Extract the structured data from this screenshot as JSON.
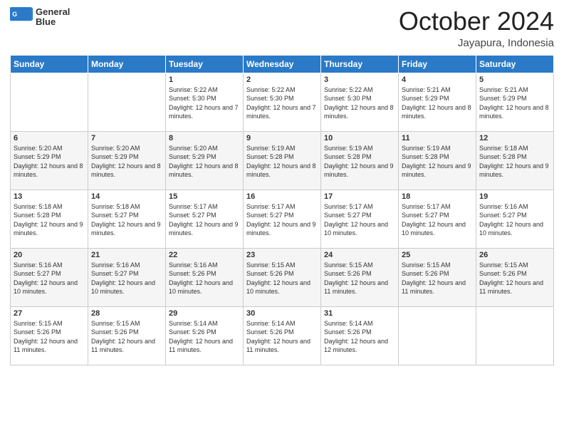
{
  "header": {
    "logo_line1": "General",
    "logo_line2": "Blue",
    "month": "October 2024",
    "location": "Jayapura, Indonesia"
  },
  "weekdays": [
    "Sunday",
    "Monday",
    "Tuesday",
    "Wednesday",
    "Thursday",
    "Friday",
    "Saturday"
  ],
  "weeks": [
    [
      {
        "day": "",
        "sunrise": "",
        "sunset": "",
        "daylight": ""
      },
      {
        "day": "",
        "sunrise": "",
        "sunset": "",
        "daylight": ""
      },
      {
        "day": "1",
        "sunrise": "Sunrise: 5:22 AM",
        "sunset": "Sunset: 5:30 PM",
        "daylight": "Daylight: 12 hours and 7 minutes."
      },
      {
        "day": "2",
        "sunrise": "Sunrise: 5:22 AM",
        "sunset": "Sunset: 5:30 PM",
        "daylight": "Daylight: 12 hours and 7 minutes."
      },
      {
        "day": "3",
        "sunrise": "Sunrise: 5:22 AM",
        "sunset": "Sunset: 5:30 PM",
        "daylight": "Daylight: 12 hours and 8 minutes."
      },
      {
        "day": "4",
        "sunrise": "Sunrise: 5:21 AM",
        "sunset": "Sunset: 5:29 PM",
        "daylight": "Daylight: 12 hours and 8 minutes."
      },
      {
        "day": "5",
        "sunrise": "Sunrise: 5:21 AM",
        "sunset": "Sunset: 5:29 PM",
        "daylight": "Daylight: 12 hours and 8 minutes."
      }
    ],
    [
      {
        "day": "6",
        "sunrise": "Sunrise: 5:20 AM",
        "sunset": "Sunset: 5:29 PM",
        "daylight": "Daylight: 12 hours and 8 minutes."
      },
      {
        "day": "7",
        "sunrise": "Sunrise: 5:20 AM",
        "sunset": "Sunset: 5:29 PM",
        "daylight": "Daylight: 12 hours and 8 minutes."
      },
      {
        "day": "8",
        "sunrise": "Sunrise: 5:20 AM",
        "sunset": "Sunset: 5:29 PM",
        "daylight": "Daylight: 12 hours and 8 minutes."
      },
      {
        "day": "9",
        "sunrise": "Sunrise: 5:19 AM",
        "sunset": "Sunset: 5:28 PM",
        "daylight": "Daylight: 12 hours and 8 minutes."
      },
      {
        "day": "10",
        "sunrise": "Sunrise: 5:19 AM",
        "sunset": "Sunset: 5:28 PM",
        "daylight": "Daylight: 12 hours and 9 minutes."
      },
      {
        "day": "11",
        "sunrise": "Sunrise: 5:19 AM",
        "sunset": "Sunset: 5:28 PM",
        "daylight": "Daylight: 12 hours and 9 minutes."
      },
      {
        "day": "12",
        "sunrise": "Sunrise: 5:18 AM",
        "sunset": "Sunset: 5:28 PM",
        "daylight": "Daylight: 12 hours and 9 minutes."
      }
    ],
    [
      {
        "day": "13",
        "sunrise": "Sunrise: 5:18 AM",
        "sunset": "Sunset: 5:28 PM",
        "daylight": "Daylight: 12 hours and 9 minutes."
      },
      {
        "day": "14",
        "sunrise": "Sunrise: 5:18 AM",
        "sunset": "Sunset: 5:27 PM",
        "daylight": "Daylight: 12 hours and 9 minutes."
      },
      {
        "day": "15",
        "sunrise": "Sunrise: 5:17 AM",
        "sunset": "Sunset: 5:27 PM",
        "daylight": "Daylight: 12 hours and 9 minutes."
      },
      {
        "day": "16",
        "sunrise": "Sunrise: 5:17 AM",
        "sunset": "Sunset: 5:27 PM",
        "daylight": "Daylight: 12 hours and 9 minutes."
      },
      {
        "day": "17",
        "sunrise": "Sunrise: 5:17 AM",
        "sunset": "Sunset: 5:27 PM",
        "daylight": "Daylight: 12 hours and 10 minutes."
      },
      {
        "day": "18",
        "sunrise": "Sunrise: 5:17 AM",
        "sunset": "Sunset: 5:27 PM",
        "daylight": "Daylight: 12 hours and 10 minutes."
      },
      {
        "day": "19",
        "sunrise": "Sunrise: 5:16 AM",
        "sunset": "Sunset: 5:27 PM",
        "daylight": "Daylight: 12 hours and 10 minutes."
      }
    ],
    [
      {
        "day": "20",
        "sunrise": "Sunrise: 5:16 AM",
        "sunset": "Sunset: 5:27 PM",
        "daylight": "Daylight: 12 hours and 10 minutes."
      },
      {
        "day": "21",
        "sunrise": "Sunrise: 5:16 AM",
        "sunset": "Sunset: 5:27 PM",
        "daylight": "Daylight: 12 hours and 10 minutes."
      },
      {
        "day": "22",
        "sunrise": "Sunrise: 5:16 AM",
        "sunset": "Sunset: 5:26 PM",
        "daylight": "Daylight: 12 hours and 10 minutes."
      },
      {
        "day": "23",
        "sunrise": "Sunrise: 5:15 AM",
        "sunset": "Sunset: 5:26 PM",
        "daylight": "Daylight: 12 hours and 10 minutes."
      },
      {
        "day": "24",
        "sunrise": "Sunrise: 5:15 AM",
        "sunset": "Sunset: 5:26 PM",
        "daylight": "Daylight: 12 hours and 11 minutes."
      },
      {
        "day": "25",
        "sunrise": "Sunrise: 5:15 AM",
        "sunset": "Sunset: 5:26 PM",
        "daylight": "Daylight: 12 hours and 11 minutes."
      },
      {
        "day": "26",
        "sunrise": "Sunrise: 5:15 AM",
        "sunset": "Sunset: 5:26 PM",
        "daylight": "Daylight: 12 hours and 11 minutes."
      }
    ],
    [
      {
        "day": "27",
        "sunrise": "Sunrise: 5:15 AM",
        "sunset": "Sunset: 5:26 PM",
        "daylight": "Daylight: 12 hours and 11 minutes."
      },
      {
        "day": "28",
        "sunrise": "Sunrise: 5:15 AM",
        "sunset": "Sunset: 5:26 PM",
        "daylight": "Daylight: 12 hours and 11 minutes."
      },
      {
        "day": "29",
        "sunrise": "Sunrise: 5:14 AM",
        "sunset": "Sunset: 5:26 PM",
        "daylight": "Daylight: 12 hours and 11 minutes."
      },
      {
        "day": "30",
        "sunrise": "Sunrise: 5:14 AM",
        "sunset": "Sunset: 5:26 PM",
        "daylight": "Daylight: 12 hours and 11 minutes."
      },
      {
        "day": "31",
        "sunrise": "Sunrise: 5:14 AM",
        "sunset": "Sunset: 5:26 PM",
        "daylight": "Daylight: 12 hours and 12 minutes."
      },
      {
        "day": "",
        "sunrise": "",
        "sunset": "",
        "daylight": ""
      },
      {
        "day": "",
        "sunrise": "",
        "sunset": "",
        "daylight": ""
      }
    ]
  ]
}
